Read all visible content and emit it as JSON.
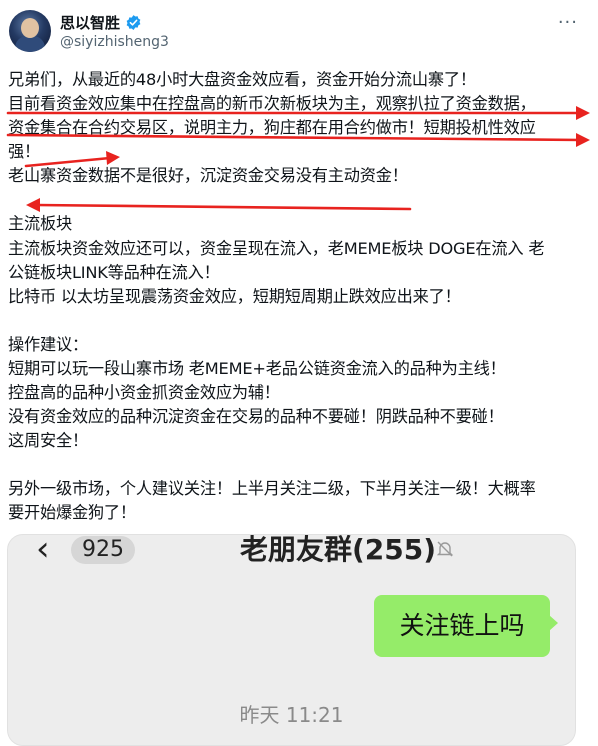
{
  "user": {
    "display_name": "思以智胜",
    "handle": "@siyizhisheng3"
  },
  "menu": {
    "more_label": "···"
  },
  "tweet": {
    "lines": [
      "兄弟们，从最近的48小时大盘资金效应看，资金开始分流山寨了！",
      "目前看资金效应集中在控盘高的新币次新板块为主，观察扒拉了资金数据，",
      "资金集合在合约交易区，说明主力，狗庄都在用合约做市！短期投机性效应",
      "强！",
      "老山寨资金数据不是很好，沉淀资金交易没有主动资金！",
      "主流板块",
      "主流板块资金效应还可以，资金呈现在流入，老MEME板块 DOGE在流入 老",
      "公链板块LINK等品种在流入！",
      "比特币 以太坊呈现震荡资金效应，短期短周期止跌效应出来了！",
      "操作建议：",
      "短期可以玩一段山寨市场 老MEME+老品公链资金流入的品种为主线！",
      "控盘高的品种小资金抓资金效应为辅！",
      "没有资金效应的品种沉淀资金在交易的品种不要碰！阴跌品种不要碰！",
      "这周安全！",
      "另外一级市场，个人建议关注！上半月关注二级，下半月关注一级！大概率",
      "要开始爆金狗了！"
    ]
  },
  "embed": {
    "unread_count": "925",
    "group_title": "老朋友群(255)",
    "message": "关注链上吗",
    "timestamp": "昨天 11:21"
  },
  "colors": {
    "annotation_red": "#e8231f",
    "wechat_green": "#95ec69",
    "verified_blue": "#1d9bf0"
  }
}
